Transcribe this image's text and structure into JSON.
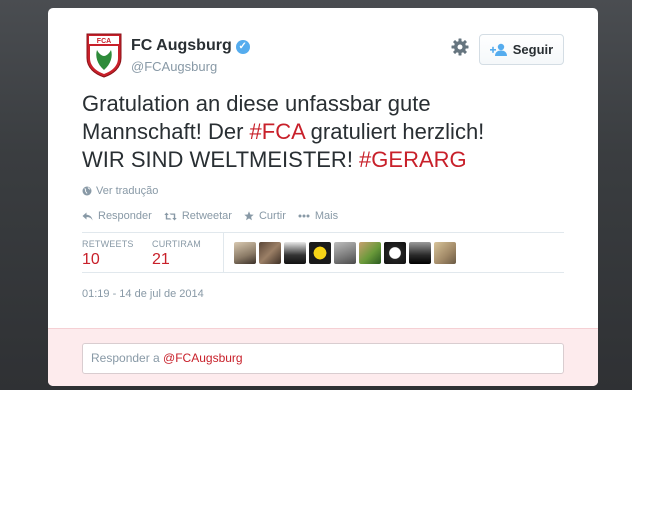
{
  "tweet": {
    "account_name": "FC Augsburg",
    "handle": "@FCAugsburg",
    "follow_label": "Seguir",
    "text_parts": {
      "line1": "Gratulation an diese unfassbar gute",
      "line2_a": "Mannschaft! Der ",
      "hashtag1": "#FCA",
      "line2_b": " gratuliert herzlich!",
      "line3_a": "WIR SIND WELTMEISTER! ",
      "hashtag2": "#GERARG"
    },
    "translate_label": "Ver tradução",
    "actions": {
      "reply": "Responder",
      "retweet": "Retweetar",
      "favorite": "Curtir",
      "more": "Mais"
    },
    "stats": {
      "retweets_label": "RETWEETS",
      "retweets_value": "10",
      "favorites_label": "CURTIRAM",
      "favorites_value": "21"
    },
    "timestamp": "01:19 - 14 de jul de 2014",
    "reply_placeholder_prefix": "Responder a ",
    "reply_placeholder_mention": "@FCAugsburg"
  },
  "colors": {
    "accent": "#c8202a",
    "muted": "#8899a6",
    "text": "#292f33",
    "verified": "#55acee",
    "reply_bg": "#fdebed"
  },
  "icons": [
    "fca-crest-logo",
    "verified-badge-icon",
    "gear-icon",
    "follow-person-icon",
    "globe-icon",
    "reply-icon",
    "retweet-icon",
    "star-icon",
    "more-dots-icon"
  ]
}
